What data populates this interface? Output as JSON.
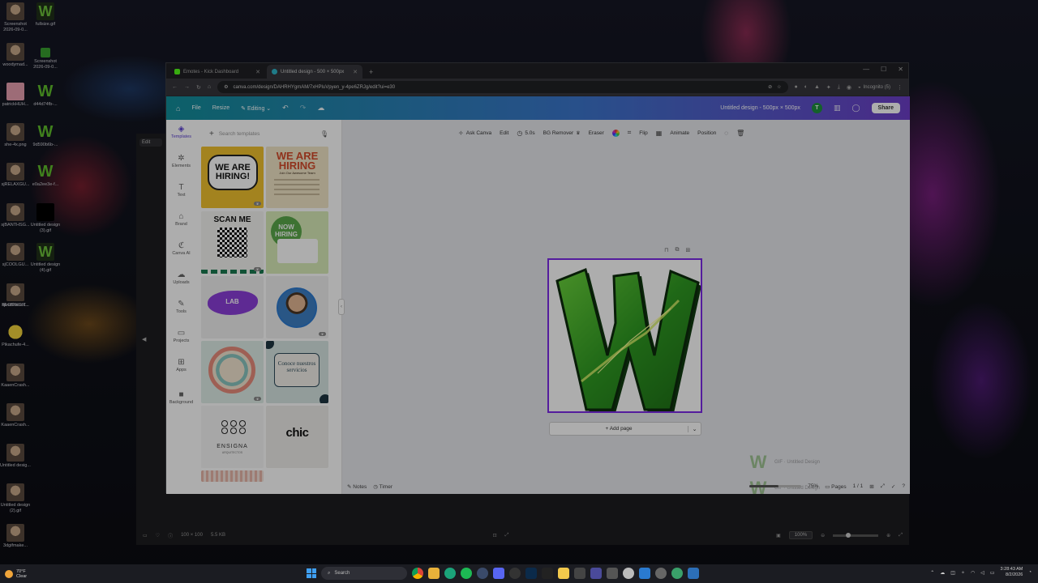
{
  "desktop": {
    "icons": [
      {
        "label": "Screenshot 2026-09-0...",
        "kind": "face"
      },
      {
        "label": "fullsize.gif",
        "kind": "w"
      },
      {
        "label": "woodymad...",
        "kind": "face"
      },
      {
        "label": "Screenshot 2026-09-0...",
        "kind": "green"
      },
      {
        "label": "patrickHUH...",
        "kind": "pink"
      },
      {
        "label": "d44d74fb-...",
        "kind": "wb"
      },
      {
        "label": "she-4x.png",
        "kind": "face"
      },
      {
        "label": "9d590b6b-...",
        "kind": "wb"
      },
      {
        "label": "sjRELAXGU...",
        "kind": "face"
      },
      {
        "label": "e0a2ee3e-f...",
        "kind": "wb"
      },
      {
        "label": "sjBANTHSG...",
        "kind": "face"
      },
      {
        "label": "Untitled design (3).gif",
        "kind": "black"
      },
      {
        "label": "sjCOOLGU...",
        "kind": "face"
      },
      {
        "label": "Untitled design (4).gif",
        "kind": "w"
      },
      {
        "label": "sjLOSINGIT...",
        "kind": "face"
      },
      {
        "label": "BlindPatrick...",
        "kind": "face"
      },
      {
        "label": "Pikachufe-4...",
        "kind": "pika"
      },
      {
        "label": "KaaenCrash...",
        "kind": "face"
      },
      {
        "label": "KaaenCrash...",
        "kind": "face"
      },
      {
        "label": "Untitled desig...",
        "kind": "face"
      },
      {
        "label": "Untitled design (2).gif",
        "kind": "face"
      },
      {
        "label": "3dgifmake...",
        "kind": "face"
      }
    ]
  },
  "browser": {
    "tabs": [
      {
        "title": "Emotes - Kick Dashboard",
        "active": false,
        "color": "#53fc18"
      },
      {
        "title": "Untitled design - 500 × 500px",
        "active": true,
        "color": "#2fb6c9"
      }
    ],
    "new_tab": "+",
    "url": "canva.com/design/DAHRHYgmAM/7xHPluVpyen_y-4pe6ZRJg/edit?ui=e30",
    "incognito_label": "Incognito (5)"
  },
  "canva": {
    "topbar": {
      "file": "File",
      "resize": "Resize",
      "editing": "Editing",
      "doc_title": "Untitled design - 500px × 500px",
      "avatar": "T",
      "share": "Share"
    },
    "nav": [
      {
        "label": "Templates",
        "icon": "templates-icon",
        "glyph": "◈",
        "active": true
      },
      {
        "label": "Elements",
        "icon": "elements-icon",
        "glyph": "✲"
      },
      {
        "label": "Text",
        "icon": "text-icon",
        "glyph": "T"
      },
      {
        "label": "Brand",
        "icon": "brand-icon",
        "glyph": "⌂"
      },
      {
        "label": "Canva AI",
        "icon": "canva-ai-icon",
        "glyph": "ℭ"
      },
      {
        "label": "Uploads",
        "icon": "uploads-icon",
        "glyph": "☁"
      },
      {
        "label": "Tools",
        "icon": "tools-icon",
        "glyph": "✎"
      },
      {
        "label": "Projects",
        "icon": "projects-icon",
        "glyph": "▭"
      },
      {
        "label": "Apps",
        "icon": "apps-icon",
        "glyph": "⊞"
      },
      {
        "label": "Background",
        "icon": "background-icon",
        "glyph": "■"
      }
    ],
    "search_placeholder": "Search templates",
    "templates": {
      "t1": "WE ARE HIRING!",
      "t2_head": "WE ARE HIRING",
      "t2_sub": "Join Our Awesome Team",
      "t3": "SCAN ME",
      "t4": "NOW HIRING",
      "t5": "LAB",
      "t8": "Conoce nuestros servicios",
      "t9_name": "ENSIGNA",
      "t9_sub": "ARQUITECTOS",
      "t10": "chic"
    },
    "toolbar": {
      "ask_canva": "Ask Canva",
      "edit": "Edit",
      "duration": "5.0s",
      "bg_remover": "BG Remover",
      "eraser": "Eraser",
      "flip": "Flip",
      "animate": "Animate",
      "position": "Position"
    },
    "add_page": "+ Add page",
    "ghost_rows": [
      {
        "label": "GIF · Untitled Design"
      },
      {
        "label": "GIF · Untitled Design"
      }
    ],
    "bottom": {
      "notes": "Notes",
      "timer": "Timer",
      "zoom": "75%",
      "pages": "Pages",
      "page_count": "1 / 1"
    }
  },
  "outer": {
    "edit_btn": "Edit",
    "dims": "100 × 100",
    "size": "5.5 KB",
    "zoom": "100%"
  },
  "taskbar": {
    "temp": "70°F",
    "condition": "Clear",
    "search": "Search",
    "time": "3:28:43 AM",
    "date": "8/2/2026"
  }
}
